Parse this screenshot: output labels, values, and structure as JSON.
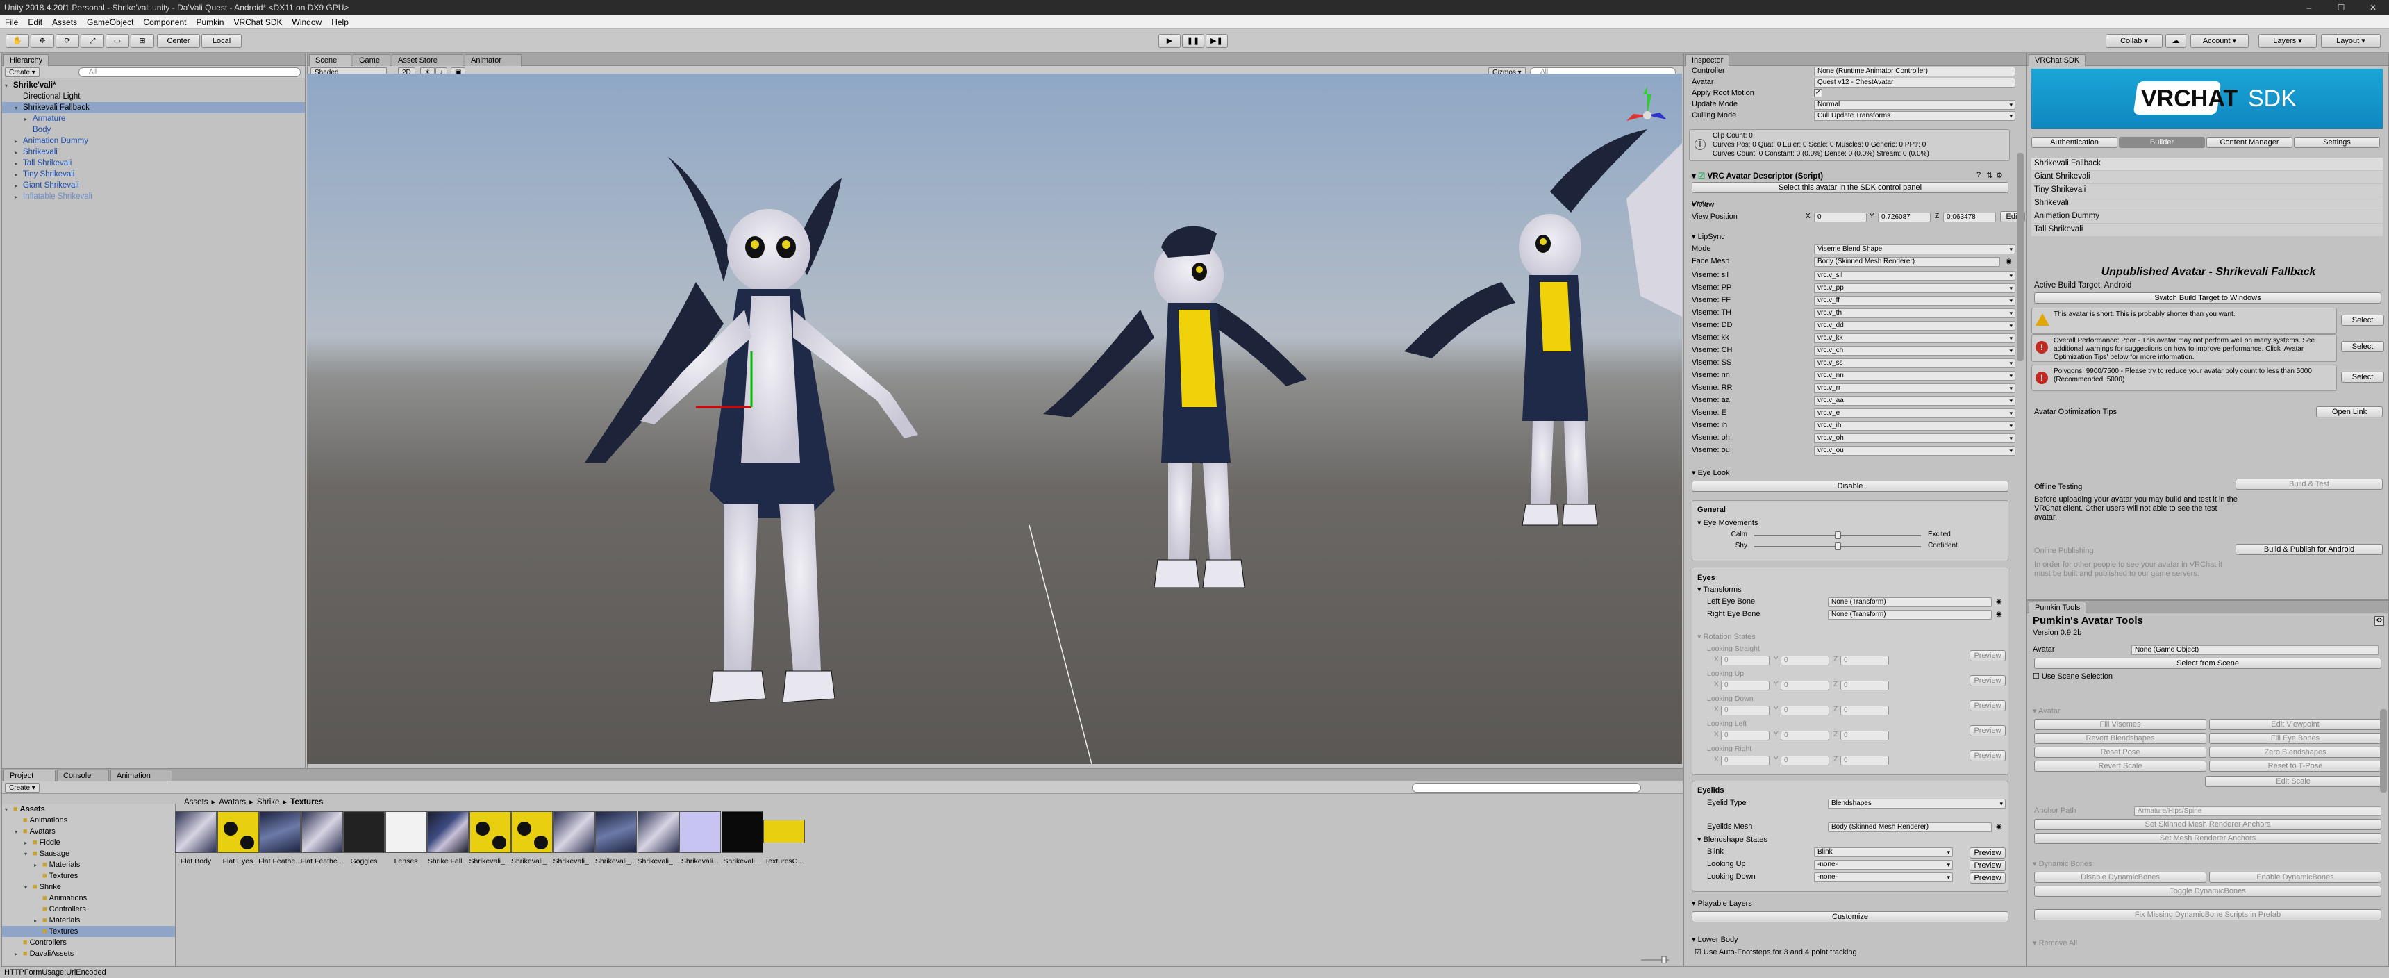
{
  "titlebar": {
    "title": "Unity 2018.4.20f1 Personal - Shrike'vali.unity - Da'Vali Quest - Android* <DX11 on DX9 GPU>"
  },
  "menu": [
    "File",
    "Edit",
    "Assets",
    "GameObject",
    "Component",
    "Pumkin",
    "VRChat SDK",
    "Window",
    "Help"
  ],
  "toolbar": {
    "center": "Center",
    "local": "Local",
    "collab": "Collab ▾",
    "account": "Account ▾",
    "layers": "Layers ▾",
    "layout": "Layout ▾"
  },
  "hierarchy": {
    "tab": "Hierarchy",
    "create": "Create ▾",
    "search": "All",
    "items": [
      {
        "label": "Shrike'vali*",
        "indent": 0,
        "arrow": "▾",
        "style": "bold"
      },
      {
        "label": "Directional Light",
        "indent": 1,
        "arrow": "",
        "style": "plain"
      },
      {
        "label": "Shrikevali Fallback",
        "indent": 1,
        "arrow": "▾",
        "style": "selected"
      },
      {
        "label": "Armature",
        "indent": 2,
        "arrow": "▸",
        "style": "blue"
      },
      {
        "label": "Body",
        "indent": 2,
        "arrow": "",
        "style": "blue"
      },
      {
        "label": "Animation Dummy",
        "indent": 1,
        "arrow": "▸",
        "style": "blue"
      },
      {
        "label": "Shrikevali",
        "indent": 1,
        "arrow": "▸",
        "style": "blue"
      },
      {
        "label": "Tall Shrikevali",
        "indent": 1,
        "arrow": "▸",
        "style": "blue"
      },
      {
        "label": "Tiny Shrikevali",
        "indent": 1,
        "arrow": "▸",
        "style": "blue"
      },
      {
        "label": "Giant Shrikevali",
        "indent": 1,
        "arrow": "▸",
        "style": "blue"
      },
      {
        "label": "Inflatable Shrikevali",
        "indent": 1,
        "arrow": "▸",
        "style": "faded"
      }
    ]
  },
  "scene": {
    "tabs": [
      "Scene",
      "Game",
      "Asset Store",
      "Animator"
    ],
    "shading": "Shaded",
    "mode2d": "2D",
    "gizmos": "Gizmos ▾",
    "search": "All"
  },
  "project": {
    "tabs": [
      "Project",
      "Console",
      "Animation"
    ],
    "create": "Create ▾",
    "tree": [
      {
        "label": "Assets",
        "indent": 0,
        "arrow": "▾",
        "bold": true
      },
      {
        "label": "Animations",
        "indent": 1,
        "arrow": ""
      },
      {
        "label": "Avatars",
        "indent": 1,
        "arrow": "▾"
      },
      {
        "label": "Fiddle",
        "indent": 2,
        "arrow": "▸"
      },
      {
        "label": "Sausage",
        "indent": 2,
        "arrow": "▾"
      },
      {
        "label": "Materials",
        "indent": 3,
        "arrow": "▸"
      },
      {
        "label": "Textures",
        "indent": 3,
        "arrow": ""
      },
      {
        "label": "Shrike",
        "indent": 2,
        "arrow": "▾"
      },
      {
        "label": "Animations",
        "indent": 3,
        "arrow": ""
      },
      {
        "label": "Controllers",
        "indent": 3,
        "arrow": ""
      },
      {
        "label": "Materials",
        "indent": 3,
        "arrow": "▸"
      },
      {
        "label": "Textures",
        "indent": 3,
        "arrow": "",
        "selected": true
      },
      {
        "label": "Controllers",
        "indent": 1,
        "arrow": ""
      },
      {
        "label": "DavaliAssets",
        "indent": 1,
        "arrow": "▸"
      }
    ],
    "breadcrumb": [
      "Assets",
      "Avatars",
      "Shrike",
      "Textures"
    ],
    "assets": [
      {
        "label": "Flat Body",
        "kind": "fur"
      },
      {
        "label": "Flat Eyes",
        "kind": "eyes"
      },
      {
        "label": "Flat Feathe...",
        "kind": "feather"
      },
      {
        "label": "Flat Feathe...",
        "kind": "fur"
      },
      {
        "label": "Goggles",
        "kind": "dark"
      },
      {
        "label": "Lenses",
        "kind": "white"
      },
      {
        "label": "Shrike Fall...",
        "kind": "atlas"
      },
      {
        "label": "Shrikevali_...",
        "kind": "eyes"
      },
      {
        "label": "Shrikevali_...",
        "kind": "eyes"
      },
      {
        "label": "Shrikevali_...",
        "kind": "fur"
      },
      {
        "label": "Shrikevali_...",
        "kind": "feather"
      },
      {
        "label": "Shrikevali_...",
        "kind": "fur"
      },
      {
        "label": "Shrikevali...",
        "kind": "lavender"
      },
      {
        "label": "Shrikevali...",
        "kind": "black"
      },
      {
        "label": "TexturesC...",
        "kind": "yellow"
      }
    ]
  },
  "status": {
    "text": "HTTPFormUsage:UrlEncoded"
  },
  "inspector": {
    "tab": "Inspector",
    "top": [
      {
        "label": "Controller",
        "value": "None (Runtime Animator Controller)"
      },
      {
        "label": "Avatar",
        "value": "Quest v12 - ChestAvatar"
      },
      {
        "label": "Apply Root Motion",
        "value": "✓"
      },
      {
        "label": "Update Mode",
        "value": "Normal"
      },
      {
        "label": "Culling Mode",
        "value": "Cull Update Transforms"
      }
    ],
    "info": [
      "Clip Count: 0",
      "Curves Pos: 0 Quat: 0 Euler: 0 Scale: 0 Muscles: 0 Generic: 0 PPtr: 0",
      "Curves Count: 0 Constant: 0 (0.0%) Dense: 0 (0.0%) Stream: 0 (0.0%)"
    ],
    "descriptor": "VRC Avatar Descriptor (Script)",
    "select_sdk": "Select this avatar in the SDK control panel",
    "view": "View",
    "view_position": {
      "label": "View Position",
      "x": "0",
      "y": "0.726087",
      "z": "0.063478",
      "edit": "Edit"
    },
    "lipsync": "LipSync",
    "mode": {
      "label": "Mode",
      "value": "Viseme Blend Shape"
    },
    "face_mesh": {
      "label": "Face Mesh",
      "value": "Body (Skinned Mesh Renderer)"
    },
    "visemes": [
      {
        "label": "Viseme: sil",
        "value": "vrc.v_sil"
      },
      {
        "label": "Viseme: PP",
        "value": "vrc.v_pp"
      },
      {
        "label": "Viseme: FF",
        "value": "vrc.v_ff"
      },
      {
        "label": "Viseme: TH",
        "value": "vrc.v_th"
      },
      {
        "label": "Viseme: DD",
        "value": "vrc.v_dd"
      },
      {
        "label": "Viseme: kk",
        "value": "vrc.v_kk"
      },
      {
        "label": "Viseme: CH",
        "value": "vrc.v_ch"
      },
      {
        "label": "Viseme: SS",
        "value": "vrc.v_ss"
      },
      {
        "label": "Viseme: nn",
        "value": "vrc.v_nn"
      },
      {
        "label": "Viseme: RR",
        "value": "vrc.v_rr"
      },
      {
        "label": "Viseme: aa",
        "value": "vrc.v_aa"
      },
      {
        "label": "Viseme: E",
        "value": "vrc.v_e"
      },
      {
        "label": "Viseme: ih",
        "value": "vrc.v_ih"
      },
      {
        "label": "Viseme: oh",
        "value": "vrc.v_oh"
      },
      {
        "label": "Viseme: ou",
        "value": "vrc.v_ou"
      }
    ],
    "eye_look": "Eye Look",
    "disable": "Disable",
    "general": "General",
    "eye_movements": "Eye Movements",
    "calm": "Calm",
    "excited": "Excited",
    "shy": "Shy",
    "confident": "Confident",
    "eyes": "Eyes",
    "transforms": "Transforms",
    "left_eye": {
      "label": "Left Eye Bone",
      "value": "None (Transform)"
    },
    "right_eye": {
      "label": "Right Eye Bone",
      "value": "None (Transform)"
    },
    "rotation_states": "Rotation States",
    "looks": [
      "Looking Straight",
      "Looking Up",
      "Looking Down",
      "Looking Left",
      "Looking Right"
    ],
    "preview": "Preview",
    "eyelids": "Eyelids",
    "eyelid_type": {
      "label": "Eyelid Type",
      "value": "Blendshapes"
    },
    "eyelids_mesh": {
      "label": "Eyelids Mesh",
      "value": "Body (Skinned Mesh Renderer)"
    },
    "blendshape_states": "Blendshape States",
    "blink": {
      "label": "Blink",
      "value": "Blink"
    },
    "looking_up": {
      "label": "Looking Up",
      "value": "-none-"
    },
    "looking_down": {
      "label": "Looking Down",
      "value": "-none-"
    },
    "playable_layers": "Playable Layers",
    "customize": "Customize",
    "lower_body": "Lower Body",
    "auto_footsteps": "Use Auto-Footsteps for 3 and 4 point tracking"
  },
  "sdk": {
    "tab": "VRChat SDK",
    "logo": "VRCHAT",
    "logo_sdk": "SDK",
    "tabs": [
      "Authentication",
      "Builder",
      "Content Manager",
      "Settings"
    ],
    "avatars": [
      "Shrikevali Fallback",
      "Giant Shrikevali",
      "Tiny Shrikevali",
      "Shrikevali",
      "Animation Dummy",
      "Tall Shrikevali"
    ],
    "unpublished": "Unpublished Avatar - Shrikevali Fallback",
    "active_build": "Active Build Target: Android",
    "switch": "Switch Build Target to Windows",
    "warnings": [
      {
        "text": "This avatar is short. This is probably shorter than you want.",
        "icon": "warn"
      },
      {
        "text": "Overall Performance: Poor - This avatar may not perform well on many systems. See additional warnings for suggestions on how to improve performance. Click 'Avatar Optimization Tips' below for more information.",
        "icon": "error"
      },
      {
        "text": "Polygons: 9900/7500 - Please try to reduce your avatar poly count to less than 5000 (Recommended: 5000)",
        "icon": "error"
      }
    ],
    "select": "Select",
    "opt_tips": "Avatar Optimization Tips",
    "open_link": "Open Link",
    "offline": "Offline Testing",
    "build_test": "Build & Test",
    "offline_desc": "Before uploading your avatar you may build and test it in the VRChat client. Other users will not able to see the test avatar.",
    "online": "Online Publishing",
    "build_publish": "Build & Publish for Android",
    "online_desc": "In order for other people to see your avatar in VRChat it must be built and published to our game servers."
  },
  "pumkin": {
    "tab": "Pumkin Tools",
    "title": "Pumkin's Avatar Tools",
    "version": "Version 0.9.2b",
    "avatar_label": "Avatar",
    "avatar_value": "None (Game Object)",
    "select_scene": "Select from Scene",
    "use_scene": "Use Scene Selection",
    "avatar_section": "Avatar",
    "grid": [
      [
        "Fill Visemes",
        "Edit Viewpoint"
      ],
      [
        "Revert Blendshapes",
        "Fill Eye Bones"
      ],
      [
        "Reset Pose",
        "Zero Blendshapes"
      ],
      [
        "Revert Scale",
        "Reset to T-Pose"
      ]
    ],
    "edit_scale": "Edit Scale",
    "anchor_label": "Anchor Path",
    "anchor_value": "Armature/Hips/Spine",
    "set_skinned": "Set Skinned Mesh Renderer Anchors",
    "set_mesh": "Set Mesh Renderer Anchors",
    "dyn": "Dynamic Bones",
    "disable_dyn": "Disable DynamicBones",
    "enable_dyn": "Enable DynamicBones",
    "toggle_dyn": "Toggle DynamicBones",
    "fix_dyn": "Fix Missing DynamicBone Scripts in Prefab",
    "remove_all": "Remove All"
  }
}
